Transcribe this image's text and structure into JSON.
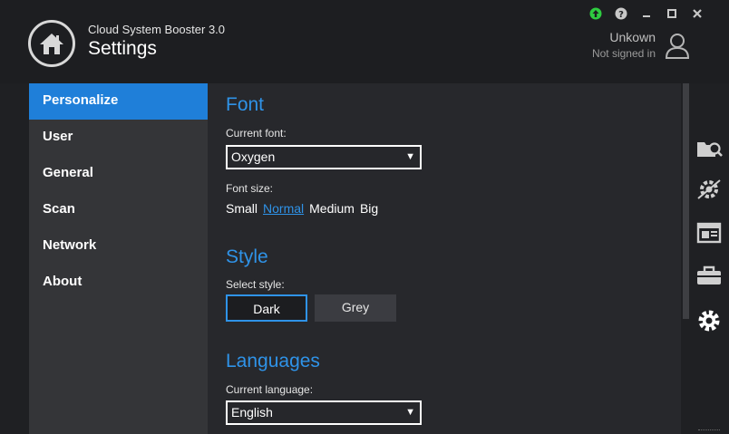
{
  "header": {
    "app_title": "Cloud System Booster 3.0",
    "page_title": "Settings",
    "user_name": "Unkown",
    "user_status": "Not signed in"
  },
  "titlebar_icons": [
    "upload-icon",
    "help-icon",
    "minimize-icon",
    "maximize-icon",
    "close-icon"
  ],
  "sidebar": {
    "items": [
      {
        "label": "Personalize",
        "active": true
      },
      {
        "label": "User"
      },
      {
        "label": "General"
      },
      {
        "label": "Scan"
      },
      {
        "label": "Network"
      },
      {
        "label": "About"
      }
    ]
  },
  "font_section": {
    "title": "Font",
    "current_font_label": "Current font:",
    "current_font_value": "Oxygen",
    "font_size_label": "Font size:",
    "sizes": [
      "Small",
      "Normal",
      "Medium",
      "Big"
    ],
    "selected_size": "Normal"
  },
  "style_section": {
    "title": "Style",
    "select_label": "Select style:",
    "dark_label": "Dark",
    "grey_label": "Grey",
    "selected": "Dark"
  },
  "language_section": {
    "title": "Languages",
    "current_language_label": "Current language:",
    "current_language_value": "English"
  },
  "rail_icons": [
    "scan-folder-icon",
    "settings-network-icon",
    "browser-window-icon",
    "toolbox-icon",
    "gear-icon"
  ],
  "colors": {
    "accent": "#1f7fd9",
    "heading": "#2f93e8",
    "status_green": "#2ecc40"
  }
}
